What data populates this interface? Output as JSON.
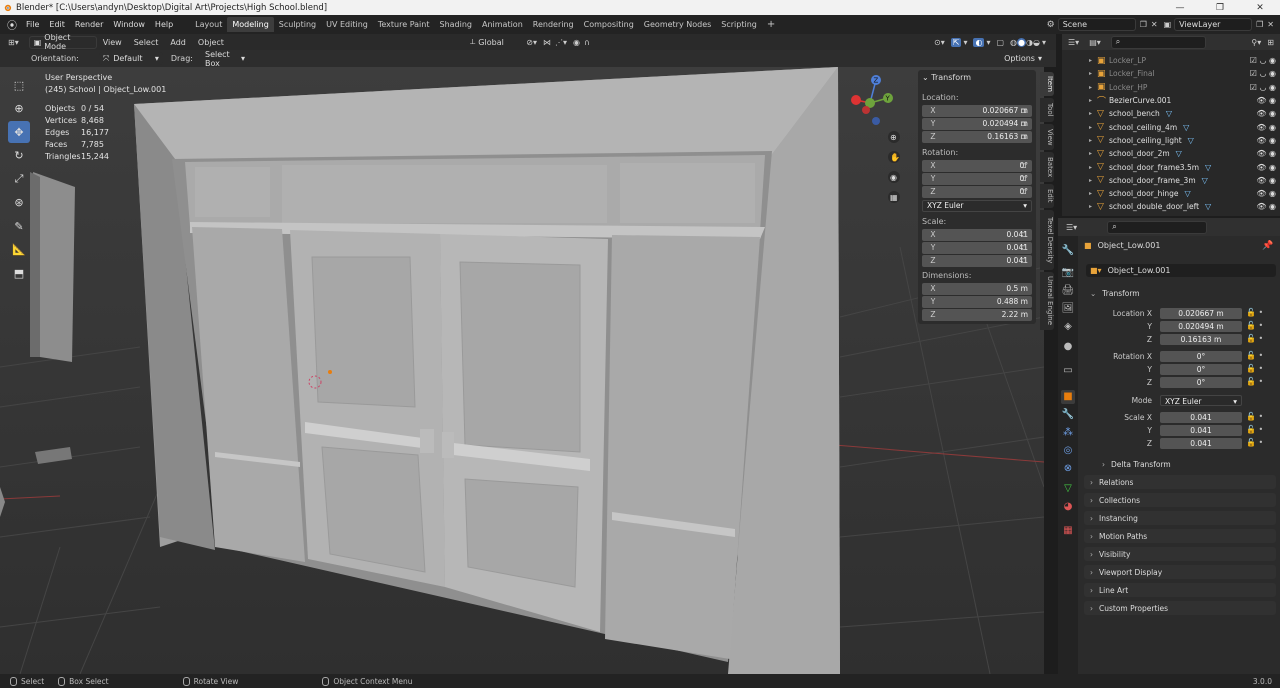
{
  "window": {
    "title": "Blender* [C:\\Users\\andyn\\Desktop\\Digital Art\\Projects\\High School.blend]"
  },
  "menu": [
    "File",
    "Edit",
    "Render",
    "Window",
    "Help"
  ],
  "workspaces": [
    "Layout",
    "Modeling",
    "Sculpting",
    "UV Editing",
    "Texture Paint",
    "Shading",
    "Animation",
    "Rendering",
    "Compositing",
    "Geometry Nodes",
    "Scripting"
  ],
  "active_workspace": "Modeling",
  "scene": {
    "label": "Scene",
    "view_layer": "ViewLayer"
  },
  "header3d": {
    "mode": "Object Mode",
    "menus": [
      "View",
      "Select",
      "Add",
      "Object"
    ],
    "transform_orientation": "Global"
  },
  "tool_options": {
    "orientation_label": "Orientation:",
    "orientation_value": "Default",
    "drag_label": "Drag:",
    "drag_value": "Select Box",
    "options_label": "Options"
  },
  "viewport": {
    "view_name": "User Perspective",
    "object_info": "(245) School | Object_Low.001",
    "stats": [
      {
        "label": "Objects",
        "value": "0 / 54"
      },
      {
        "label": "Vertices",
        "value": "8,468"
      },
      {
        "label": "Edges",
        "value": "16,177"
      },
      {
        "label": "Faces",
        "value": "7,785"
      },
      {
        "label": "Triangles",
        "value": "15,244"
      }
    ]
  },
  "npanel": {
    "header": "Transform",
    "location_label": "Location:",
    "location": [
      "0.020667 m",
      "0.020494 m",
      "0.16163 m"
    ],
    "rotation_label": "Rotation:",
    "rotation": [
      "0°",
      "0°",
      "0°"
    ],
    "rotation_mode": "XYZ Euler",
    "scale_label": "Scale:",
    "scale": [
      "0.041",
      "0.041",
      "0.041"
    ],
    "dimensions_label": "Dimensions:",
    "dimensions": [
      "0.5 m",
      "0.488 m",
      "2.22 m"
    ],
    "axes": [
      "X",
      "Y",
      "Z"
    ],
    "tabs": [
      "Item",
      "Tool",
      "View",
      "Batex",
      "Edit",
      "Texel Density",
      "Unreal Engine"
    ]
  },
  "outliner": {
    "items": [
      {
        "name": "Locker_LP",
        "dim": true,
        "icon": "collection"
      },
      {
        "name": "Locker_Final",
        "dim": true,
        "icon": "collection"
      },
      {
        "name": "Locker_HP",
        "dim": true,
        "icon": "collection"
      },
      {
        "name": "BezierCurve.001",
        "dim": false,
        "icon": "curve"
      },
      {
        "name": "school_bench",
        "dim": false,
        "icon": "mesh"
      },
      {
        "name": "school_ceiling_4m",
        "dim": false,
        "icon": "mesh"
      },
      {
        "name": "school_ceiling_light",
        "dim": false,
        "icon": "mesh"
      },
      {
        "name": "school_door_2m",
        "dim": false,
        "icon": "mesh"
      },
      {
        "name": "school_door_frame3.5m",
        "dim": false,
        "icon": "mesh"
      },
      {
        "name": "school_door_frame_3m",
        "dim": false,
        "icon": "mesh"
      },
      {
        "name": "school_door_hinge",
        "dim": false,
        "icon": "mesh"
      },
      {
        "name": "school_double_door_left",
        "dim": false,
        "icon": "mesh"
      }
    ]
  },
  "properties": {
    "object_name": "Object_Low.001",
    "object_field": "Object_Low.001",
    "transform_header": "Transform",
    "location_x_label": "Location X",
    "rotation_x_label": "Rotation X",
    "mode_label": "Mode",
    "scale_x_label": "Scale X",
    "axis_y": "Y",
    "axis_z": "Z",
    "location": [
      "0.020667 m",
      "0.020494 m",
      "0.16163 m"
    ],
    "rotation": [
      "0°",
      "0°",
      "0°"
    ],
    "mode": "XYZ Euler",
    "scale": [
      "0.041",
      "0.041",
      "0.041"
    ],
    "delta_transform": "Delta Transform",
    "panels": [
      "Relations",
      "Collections",
      "Instancing",
      "Motion Paths",
      "Visibility",
      "Viewport Display",
      "Line Art",
      "Custom Properties"
    ]
  },
  "statusbar": {
    "select": "Select",
    "box_select": "Box Select",
    "rotate_view": "Rotate View",
    "context_menu": "Object Context Menu",
    "version": "3.0.0"
  }
}
